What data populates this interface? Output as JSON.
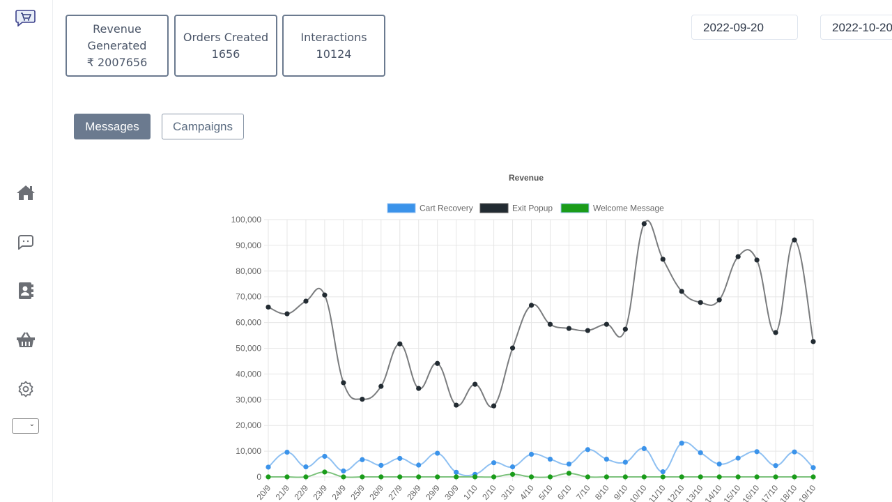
{
  "stats": [
    {
      "label_line1": "Revenue",
      "label_line2": "Generated",
      "value": "₹ 2007656"
    },
    {
      "label": "Orders Created",
      "value": "1656"
    },
    {
      "label": "Interactions",
      "value": "10124"
    }
  ],
  "date_range": {
    "start": "2022-09-20",
    "end": "2022-10-20"
  },
  "tabs": [
    {
      "label": "Messages",
      "active": true
    },
    {
      "label": "Campaigns",
      "active": false
    }
  ],
  "sidebar": {
    "icons": [
      "home-icon",
      "chat-icon",
      "contacts-icon",
      "basket-icon",
      "settings-icon"
    ],
    "select_value": ""
  },
  "colors": {
    "cart": "#3b93ea",
    "exit": "#222b32",
    "welcome": "#1a9c1a",
    "stat_border": "#6b7a8f"
  },
  "chart_data": {
    "type": "line",
    "title": "Revenue",
    "xlabel": "",
    "ylabel": "",
    "ylim": [
      0,
      100000
    ],
    "yticks": [
      0,
      10000,
      20000,
      30000,
      40000,
      50000,
      60000,
      70000,
      80000,
      90000,
      100000
    ],
    "ytick_labels": [
      "0",
      "10,000",
      "20,000",
      "30,000",
      "40,000",
      "50,000",
      "60,000",
      "70,000",
      "80,000",
      "90,000",
      "100,000"
    ],
    "legend_position": "top",
    "grid": true,
    "categories": [
      "20/9",
      "21/9",
      "22/9",
      "23/9",
      "24/9",
      "25/9",
      "26/9",
      "27/9",
      "28/9",
      "29/9",
      "30/9",
      "1/10",
      "2/10",
      "3/10",
      "4/10",
      "5/10",
      "6/10",
      "7/10",
      "8/10",
      "9/10",
      "10/10",
      "11/10",
      "12/10",
      "13/10",
      "14/10",
      "15/10",
      "16/10",
      "17/10",
      "18/10",
      "19/10"
    ],
    "series": [
      {
        "name": "Cart Recovery",
        "color": "#3b93ea",
        "values": [
          3800,
          9600,
          3900,
          8000,
          2300,
          6700,
          4500,
          7200,
          4600,
          9200,
          1800,
          1000,
          5500,
          3900,
          8800,
          6900,
          5000,
          10600,
          6900,
          5700,
          11000,
          2000,
          13100,
          9400,
          5000,
          7300,
          9800,
          4400,
          9700,
          3600
        ]
      },
      {
        "name": "Exit Popup",
        "color": "#222b32",
        "values": [
          66000,
          63400,
          68300,
          70700,
          36600,
          30200,
          35200,
          51700,
          34400,
          44100,
          27900,
          36000,
          27600,
          50100,
          66700,
          59300,
          57700,
          56900,
          59300,
          57400,
          98400,
          84600,
          72100,
          67800,
          68800,
          85600,
          84300,
          56100,
          92100,
          52600
        ]
      },
      {
        "name": "Welcome Message",
        "color": "#1a9c1a",
        "values": [
          0,
          0,
          0,
          1900,
          0,
          0,
          0,
          0,
          0,
          0,
          0,
          0,
          0,
          1000,
          0,
          0,
          1400,
          0,
          0,
          0,
          0,
          0,
          0,
          0,
          0,
          0,
          0,
          0,
          0,
          0
        ]
      }
    ]
  }
}
